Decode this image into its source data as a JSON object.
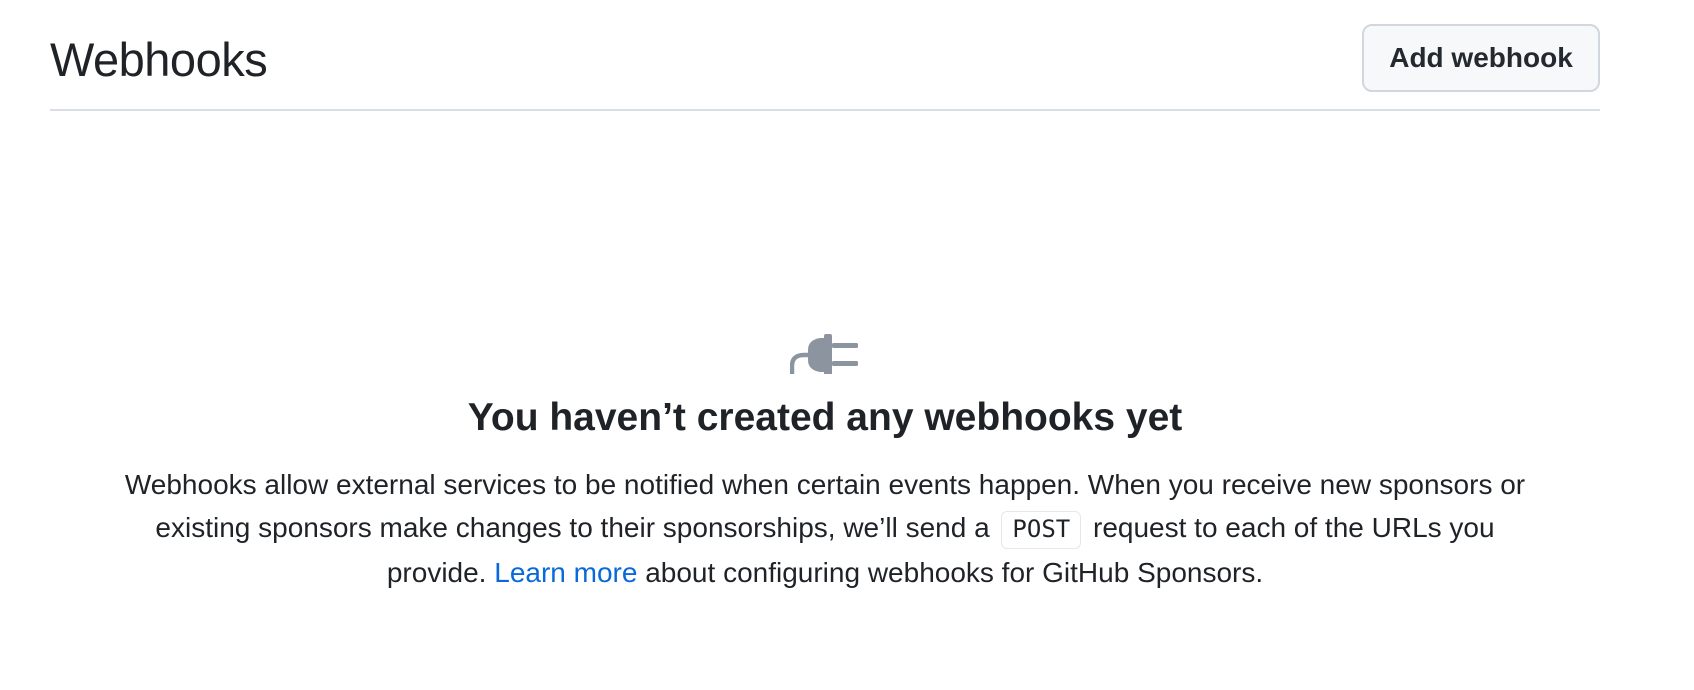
{
  "header": {
    "title": "Webhooks",
    "add_button": "Add webhook"
  },
  "blankslate": {
    "icon": "plug-icon",
    "title": "You haven’t created any webhooks yet",
    "desc_part1": "Webhooks allow external services to be notified when certain events happen. When you receive new sponsors or existing sponsors make changes to their sponsorships, we’ll send a",
    "code": "POST",
    "desc_part2": "request to each of the URLs you provide.",
    "link": "Learn more",
    "desc_part3": "about configuring webhooks for GitHub Sponsors."
  },
  "colors": {
    "link": "#0969da",
    "icon": "#8c959f",
    "button_bg": "#f6f8fa"
  }
}
